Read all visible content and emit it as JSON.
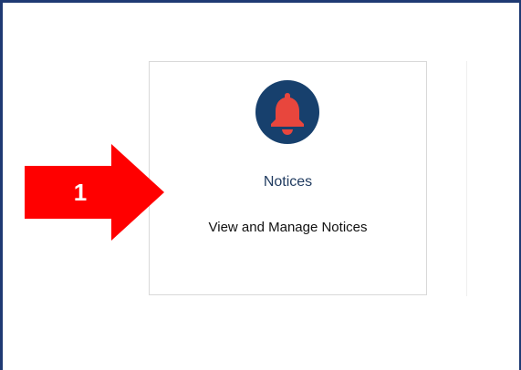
{
  "card": {
    "icon": "bell-icon",
    "title": "Notices",
    "description": "View and Manage Notices"
  },
  "annotation": {
    "step_number": "1",
    "arrow_color": "#ff0000"
  },
  "colors": {
    "frame_border": "#1f3a73",
    "icon_circle": "#17406d",
    "bell": "#e8463d",
    "title_text": "#1f3a5f"
  }
}
